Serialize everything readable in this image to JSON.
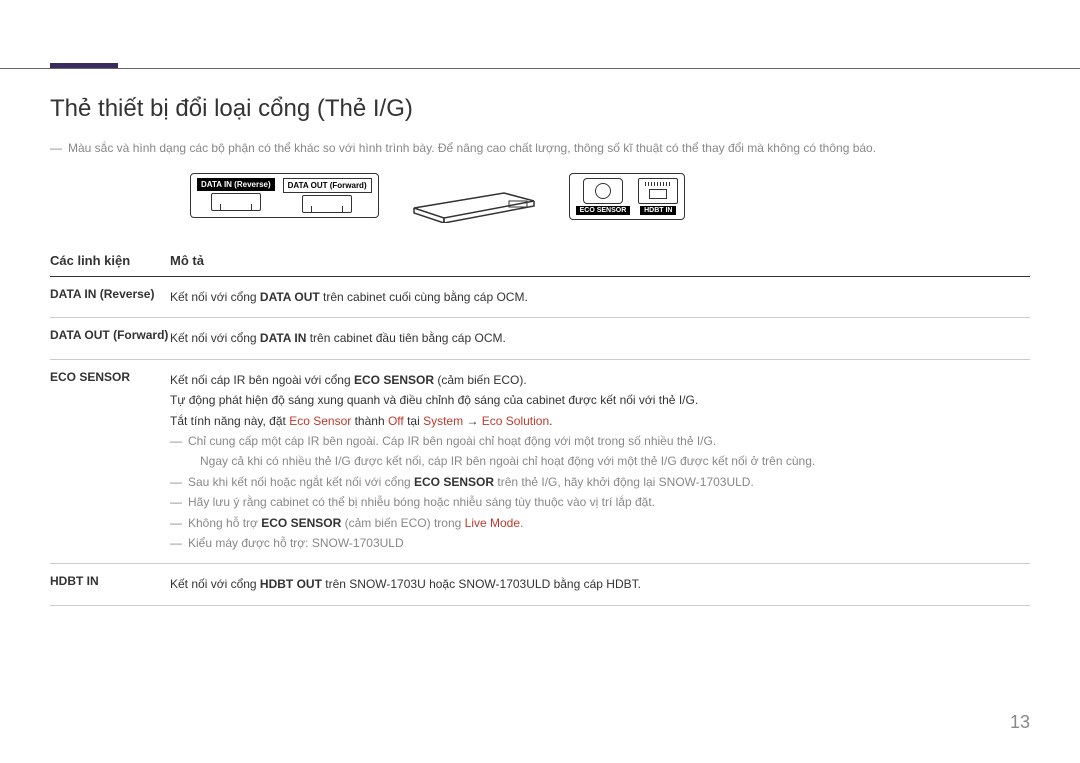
{
  "section_title": "Thẻ thiết bị đổi loại cổng (Thẻ I/G)",
  "top_note": "Màu sắc và hình dạng các bộ phận có thể khác so với hình trình bày. Để nâng cao chất lượng, thông số kĩ thuật có thể thay đổi mà không có thông báo.",
  "diagram": {
    "data_in_label": "DATA IN (Reverse)",
    "data_out_label": "DATA OUT (Forward)",
    "eco_sensor_label": "ECO SENSOR",
    "hdbt_in_label": "HDBT IN"
  },
  "table": {
    "header_component": "Các linh kiện",
    "header_description": "Mô tả",
    "rows": [
      {
        "component": "DATA IN (Reverse)",
        "desc_prefix": "Kết nối với cổng ",
        "desc_bold": "DATA OUT",
        "desc_suffix": " trên cabinet cuối cùng bằng cáp OCM."
      },
      {
        "component": "DATA OUT (Forward)",
        "desc_prefix": "Kết nối với cổng ",
        "desc_bold": "DATA IN",
        "desc_suffix": " trên cabinet đầu tiên bằng cáp OCM."
      },
      {
        "component": "ECO SENSOR",
        "line1_prefix": "Kết nối cáp IR bên ngoài với cổng ",
        "line1_bold": "ECO SENSOR",
        "line1_suffix": " (cảm biến ECO).",
        "line2": "Tự động phát hiện độ sáng xung quanh và điều chỉnh độ sáng của cabinet được kết nối với thẻ I/G.",
        "line3_prefix": "Tắt tính năng này, đặt ",
        "line3_r1": "Eco Sensor",
        "line3_mid1": " thành ",
        "line3_r2": "Off",
        "line3_mid2": " tại ",
        "line3_r3": "System",
        "line3_arrow": " → ",
        "line3_r4": "Eco Solution",
        "line3_end": ".",
        "note1": "Chỉ cung cấp một cáp IR bên ngoài. Cáp IR bên ngoài chỉ hoạt động với một trong số nhiều thẻ I/G.",
        "note1b": "Ngay cả khi có nhiều thẻ I/G được kết nối, cáp IR bên ngoài chỉ hoạt động với một thẻ I/G được kết nối ở trên cùng.",
        "note2_prefix": "Sau khi kết nối hoặc ngắt kết nối với cổng ",
        "note2_bold": "ECO SENSOR",
        "note2_suffix": " trên thẻ I/G, hãy khởi động lại SNOW-1703ULD.",
        "note3": "Hãy lưu ý rằng cabinet có thể bị nhiễu bóng hoặc nhiễu sáng tùy thuộc vào vị trí lắp đặt.",
        "note4_prefix": "Không hỗ trợ ",
        "note4_bold": "ECO SENSOR",
        "note4_mid": " (cảm biến ECO) trong ",
        "note4_red": "Live Mode",
        "note4_end": ".",
        "note5": "Kiểu máy được hỗ trợ: SNOW-1703ULD"
      },
      {
        "component": "HDBT IN",
        "desc_prefix": "Kết nối với cổng ",
        "desc_bold": "HDBT OUT",
        "desc_suffix": " trên SNOW-1703U hoặc SNOW-1703ULD bằng cáp HDBT."
      }
    ]
  },
  "page_number": "13"
}
